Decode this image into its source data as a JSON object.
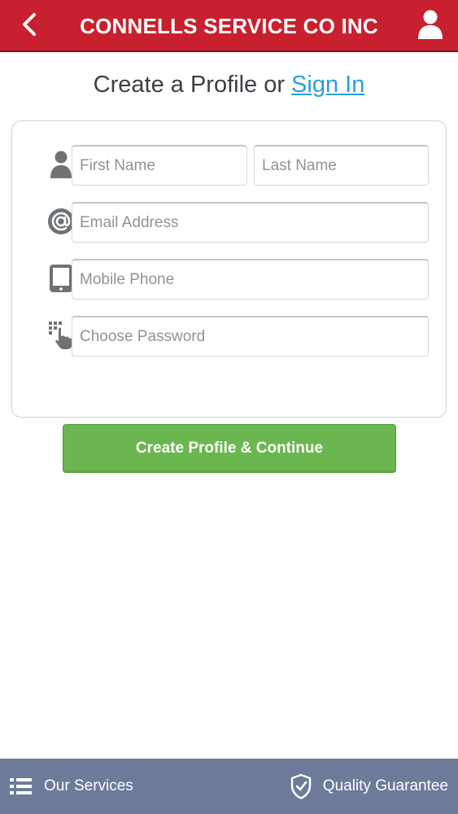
{
  "header": {
    "title": "CONNELLS SERVICE CO INC",
    "back_icon": "chevron-left-icon",
    "profile_icon": "user-icon",
    "background_color": "#c8202f"
  },
  "heading": {
    "prefix": "Create a Profile or",
    "link": "Sign In"
  },
  "form": {
    "first_name_placeholder": "First Name",
    "last_name_placeholder": "Last Name",
    "email_placeholder": "Email Address",
    "phone_placeholder": "Mobile Phone",
    "password_placeholder": "Choose Password",
    "icons": [
      "person-icon",
      "at-sign-icon",
      "tablet-icon",
      "keypad-icon"
    ]
  },
  "cta": {
    "label": "Create Profile & Continue",
    "color": "#6ab74f"
  },
  "bottom_bar": {
    "left_label": "Our Services",
    "left_icon": "list-icon",
    "right_label": "Quality Guarantee",
    "right_icon": "shield-check-icon",
    "background_color": "#6d7a99"
  }
}
